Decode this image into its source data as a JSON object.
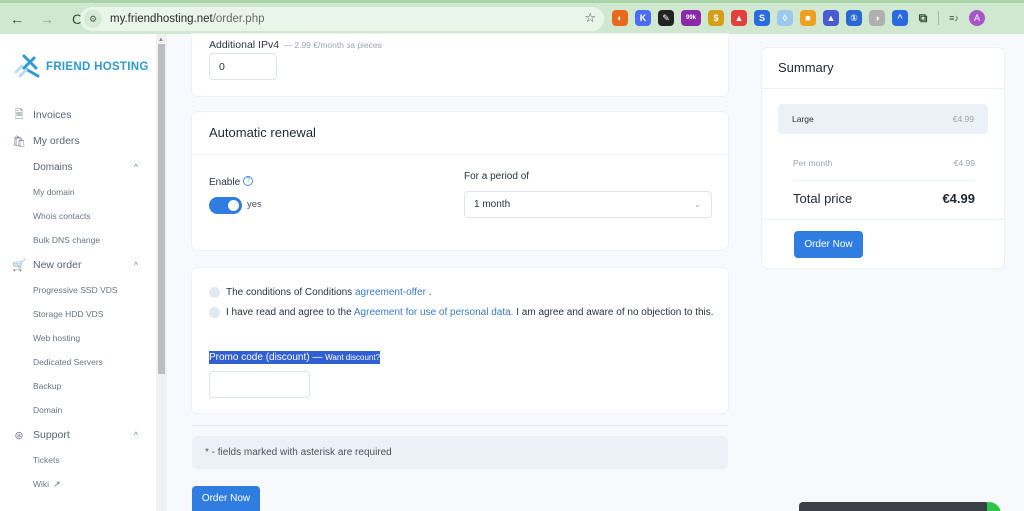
{
  "browser": {
    "url_domain": "my.friendhosting.net",
    "url_path": "/order.php",
    "back_icon": "←",
    "forward_icon": "→",
    "reload_icon": "C",
    "star_icon": "☆",
    "extensions": [
      {
        "name": "ext-1",
        "glyph": "◐",
        "color": "#e86a1c"
      },
      {
        "name": "ext-k",
        "glyph": "K",
        "color": "#4a6cf7"
      },
      {
        "name": "ext-3",
        "glyph": "✎",
        "color": "#222222"
      },
      {
        "name": "ext-badge",
        "glyph": "99k",
        "color": "#8a2aa8"
      },
      {
        "name": "ext-5",
        "glyph": "$",
        "color": "#d4a017"
      },
      {
        "name": "ext-6",
        "glyph": "▲",
        "color": "#e0413a"
      },
      {
        "name": "ext-7",
        "glyph": "S",
        "color": "#2b6be0"
      },
      {
        "name": "ext-8",
        "glyph": "◊",
        "color": "#9ec9ee"
      },
      {
        "name": "ext-9",
        "glyph": "■",
        "color": "#f0a020"
      },
      {
        "name": "ext-10",
        "glyph": "▲",
        "color": "#4a5ad0"
      },
      {
        "name": "ext-11",
        "glyph": "①",
        "color": "#2a6ad0"
      },
      {
        "name": "ext-12",
        "glyph": "◑",
        "color": "#b0b0b0"
      },
      {
        "name": "ext-13",
        "glyph": "^",
        "color": "#2a6ae0"
      },
      {
        "name": "ext-puzzle",
        "glyph": "⧉",
        "color": "#3c4a3c"
      }
    ],
    "media_icon": "≡♪",
    "profile_initial": "A"
  },
  "sidebar": {
    "brand": "FRIEND HOSTING",
    "items": [
      {
        "label": "Invoices",
        "icon": "🗎",
        "type": "item"
      },
      {
        "label": "My orders",
        "icon": "🛍",
        "type": "item"
      },
      {
        "label": "Domains",
        "type": "group",
        "chevron": "^"
      },
      {
        "label": "My domain",
        "type": "sub"
      },
      {
        "label": "Whois contacts",
        "type": "sub"
      },
      {
        "label": "Bulk DNS change",
        "type": "sub"
      },
      {
        "label": "New order",
        "icon": "🛒",
        "type": "item",
        "chevron": "^"
      },
      {
        "label": "Progressive SSD VDS",
        "type": "sub"
      },
      {
        "label": "Storage HDD VDS",
        "type": "sub"
      },
      {
        "label": "Web hosting",
        "type": "sub"
      },
      {
        "label": "Dedicated Servers",
        "type": "sub"
      },
      {
        "label": "Backup",
        "type": "sub"
      },
      {
        "label": "Domain",
        "type": "sub"
      },
      {
        "label": "Support",
        "icon": "⊛",
        "type": "item",
        "chevron": "^"
      },
      {
        "label": "Tickets",
        "type": "sub"
      },
      {
        "label": "Wiki",
        "type": "sub",
        "external": true
      }
    ]
  },
  "ipv4": {
    "label": "Additional IPv4",
    "hint": "— 2.99 €/month за pieces",
    "value": "0"
  },
  "renewal": {
    "title": "Automatic renewal",
    "enable_label": "Enable",
    "help_icon": "?",
    "toggle_on": true,
    "toggle_text": "yes",
    "period_label": "For a period of",
    "period_value": "1 month",
    "chevron": "⌄"
  },
  "agreements": {
    "line1_text": "The conditions of Conditions ",
    "line1_link": "agreement-offer",
    "line1_end": " .",
    "line2_text": "I have read and agree to the ",
    "line2_link": "Agreement for use of personal data.",
    "line2_end": " I am agree and aware of no objection to this.",
    "promo_label": "Promo code (discount) — ",
    "promo_small": "Want discount?",
    "promo_value": ""
  },
  "notice": "* - fields marked with asterisk are required",
  "order_button": "Order Now",
  "summary": {
    "title": "Summary",
    "item_name": "Large",
    "item_price": "€4.99",
    "per_month_label": "Per month",
    "per_month_value": "€4.99",
    "total_label": "Total price",
    "total_value": "€4.99",
    "order_button": "Order Now"
  },
  "colors": {
    "accent": "#2f7de1",
    "brand": "#2d9bd6",
    "link": "#3a7bd5"
  }
}
